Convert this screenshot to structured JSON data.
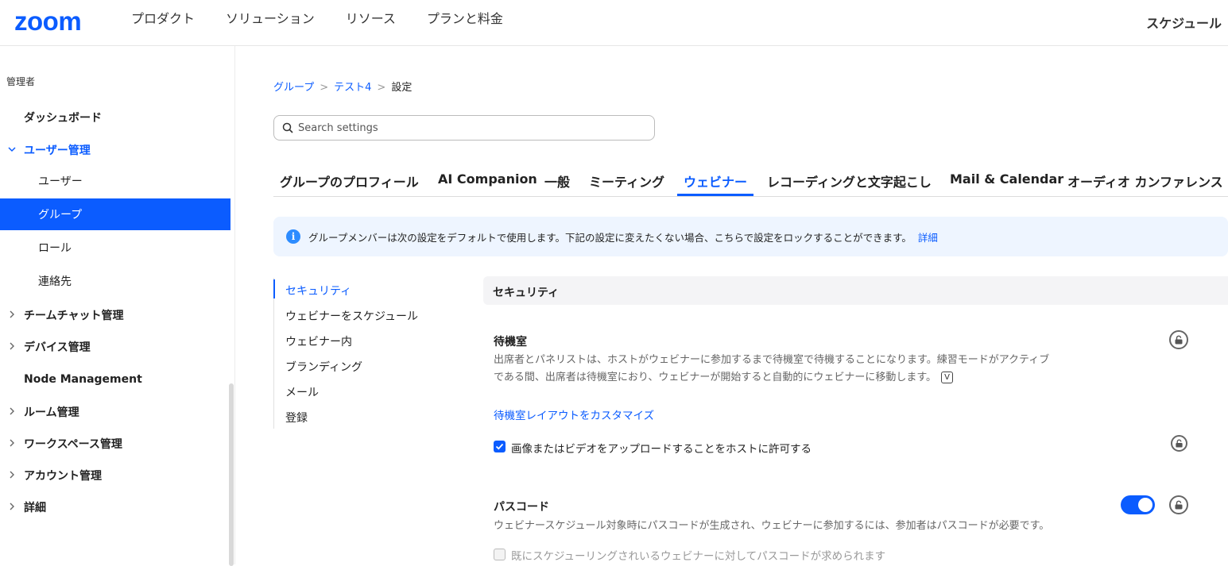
{
  "header": {
    "logo": "zoom",
    "nav": [
      "プロダクト",
      "ソリューション",
      "リソース",
      "プランと料金"
    ],
    "right": "スケジュール"
  },
  "sidebar": {
    "heading": "管理者",
    "items": [
      {
        "label": "ダッシュボード",
        "chevron": ""
      },
      {
        "label": "ユーザー管理",
        "chevron": "⌄"
      },
      {
        "label": "ユーザー",
        "chevron": ""
      },
      {
        "label": "グループ",
        "chevron": ""
      },
      {
        "label": "ロール",
        "chevron": ""
      },
      {
        "label": "連絡先",
        "chevron": ""
      },
      {
        "label": "チームチャット管理",
        "chevron": "›"
      },
      {
        "label": "デバイス管理",
        "chevron": "›"
      },
      {
        "label": "Node Management",
        "chevron": ""
      },
      {
        "label": "ルーム管理",
        "chevron": "›"
      },
      {
        "label": "ワークスペース管理",
        "chevron": "›"
      },
      {
        "label": "アカウント管理",
        "chevron": "›"
      },
      {
        "label": "詳細",
        "chevron": "›"
      }
    ]
  },
  "breadcrumb": {
    "items": [
      "グループ",
      "テスト4",
      "設定"
    ],
    "separator": ">"
  },
  "search": {
    "placeholder": "Search settings",
    "value": ""
  },
  "tabs": [
    "グループのプロフィール",
    "AI Companion",
    "一般",
    "ミーティング",
    "ウェビナー",
    "レコーディングと文字起こし",
    "Mail & Calendar",
    "オーディオ カンファレンス"
  ],
  "info": {
    "icon": "i",
    "text": "グループメンバーは次の設定をデフォルトで使用します。下記の設定に変えたくない場合、こちらで設定をロックすることができます。",
    "link": "詳細"
  },
  "subnav": [
    "セキュリティ",
    "ウェビナーをスケジュール",
    "ウェビナー内",
    "ブランディング",
    "メール",
    "登録"
  ],
  "section": {
    "title": "セキュリティ",
    "waiting_room": {
      "title": "待機室",
      "desc_line1": "出席者とパネリストは、ホストがウェビナーに参加するまで待機室で待機することになります。練習モードがアクティブ",
      "desc_line2": "である間、出席者は待機室におり、ウェビナーが開始すると自動的にウェビナーに移動します。",
      "badge": "V",
      "link": "待機室レイアウトをカスタマイズ",
      "checkbox_label": "画像またはビデオをアップロードすることをホストに許可する",
      "checkbox_checked": true
    },
    "passcode": {
      "title": "パスコード",
      "desc": "ウェビナースケジュール対象時にパスコードが生成され、ウェビナーに参加するには、参加者はパスコードが必要です。",
      "toggle_on": true,
      "checkbox_label": "既にスケジューリングされいるウェビナーに対してパスコードが求められます",
      "checkbox_checked": false
    }
  },
  "colors": {
    "accent": "#0b5cff",
    "info_bg": "#eef5ff"
  }
}
